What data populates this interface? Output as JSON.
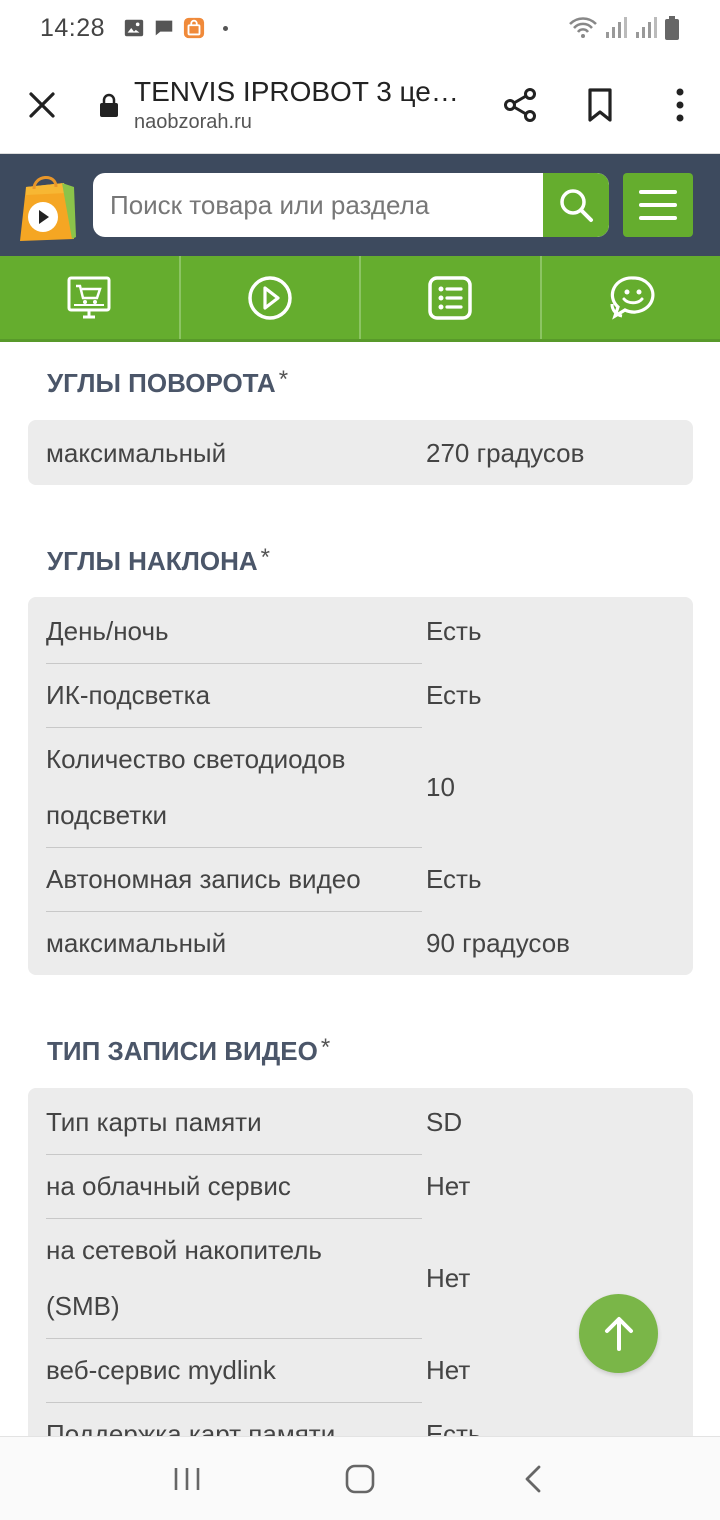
{
  "status": {
    "time": "14:28"
  },
  "browser": {
    "title": "TENVIS IPROBOT 3 це…",
    "domain": "naobzorah.ru"
  },
  "search": {
    "placeholder": "Поиск товара или раздела"
  },
  "sections": [
    {
      "title": "УГЛЫ ПОВОРОТА",
      "asterisk": "*",
      "rows": [
        {
          "name": "максимальный",
          "value": "270 градусов"
        }
      ]
    },
    {
      "title": "УГЛЫ НАКЛОНА",
      "asterisk": "*",
      "rows": [
        {
          "name": "День/ночь",
          "value": "Есть"
        },
        {
          "name": "ИК-подсветка",
          "value": "Есть"
        },
        {
          "name": "Количество светодиодов подсветки",
          "value": "10"
        },
        {
          "name": "Автономная запись видео",
          "value": "Есть"
        },
        {
          "name": "максимальный",
          "value": "90 градусов"
        }
      ]
    },
    {
      "title": "ТИП ЗАПИСИ ВИДЕО",
      "asterisk": "*",
      "rows": [
        {
          "name": "Тип карты памяти",
          "value": "SD"
        },
        {
          "name": "на облачный сервис",
          "value": "Нет"
        },
        {
          "name": "на сетевой накопитель (SMB)",
          "value": "Нет"
        },
        {
          "name": "веб-сервис mydlink",
          "value": "Нет"
        },
        {
          "name": "Поддержка карт памяти",
          "value": "Есть"
        }
      ]
    }
  ],
  "colors": {
    "header_bg": "#3d4a5e",
    "accent_green": "#65ad2e",
    "fab_green": "#7ab648",
    "spec_bg": "#ececec"
  }
}
